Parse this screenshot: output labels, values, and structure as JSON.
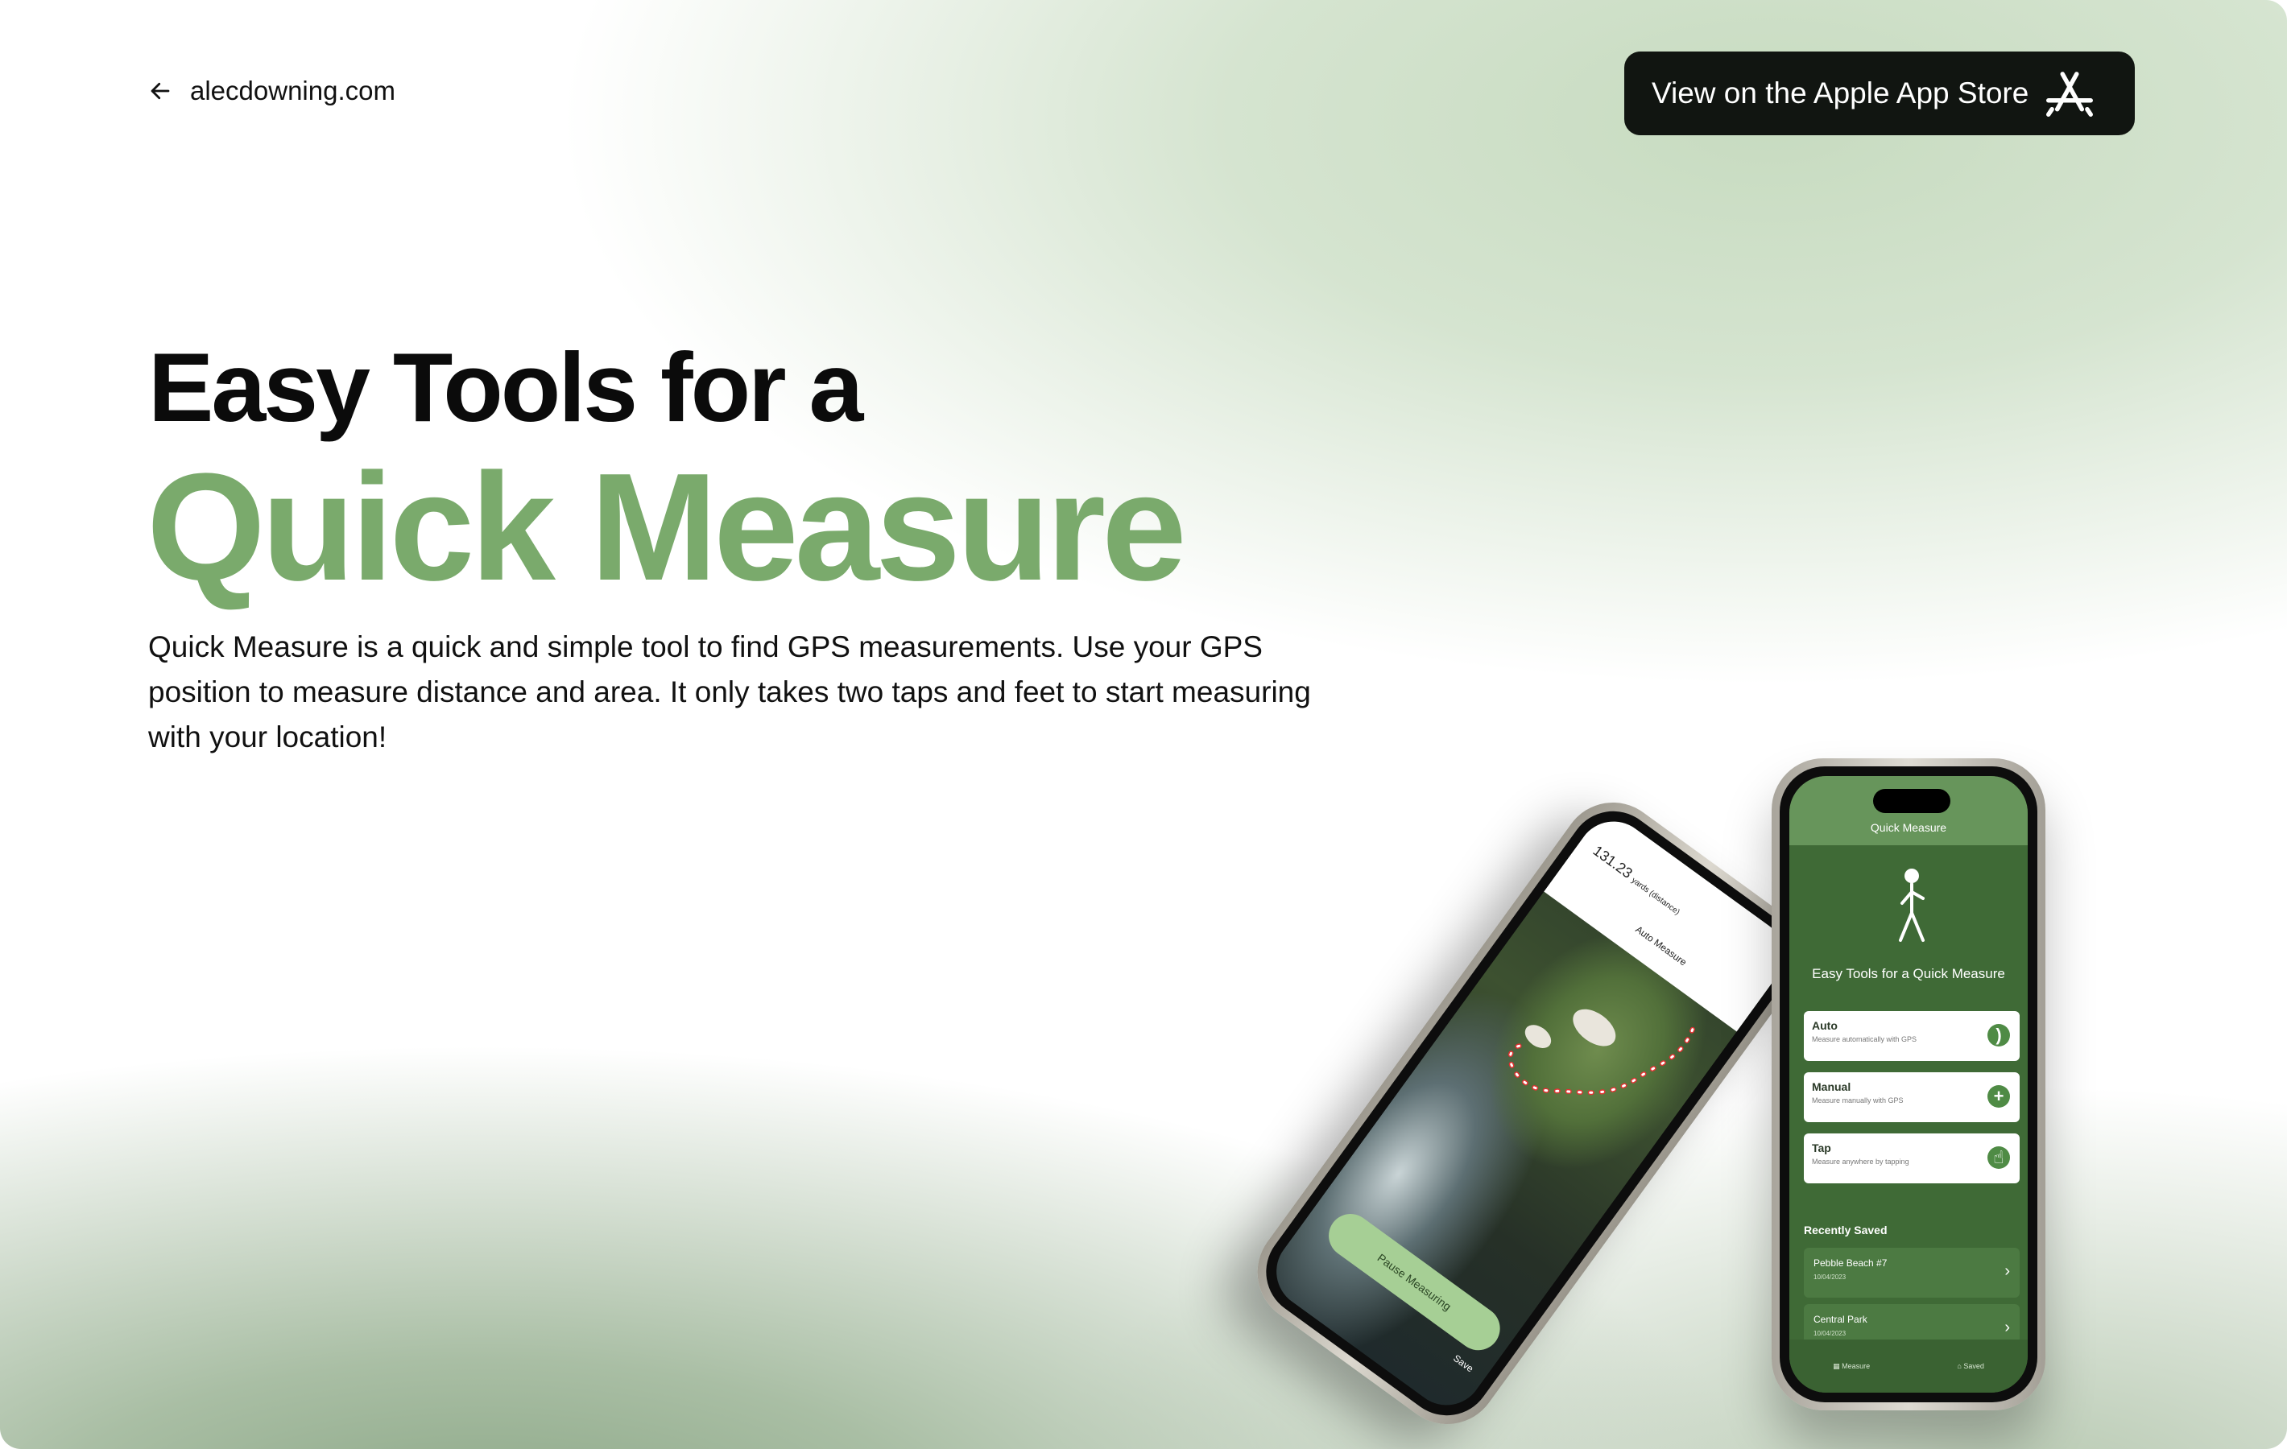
{
  "nav": {
    "back_label": "alecdowning.com",
    "store_button_label": "View on the Apple App Store"
  },
  "hero": {
    "title_line1": "Easy Tools for a",
    "title_line2": "Quick Measure",
    "description": "Quick Measure is a quick and simple tool to find GPS measurements. Use your GPS position to measure distance and area. It only takes two taps and feet to start measuring with your location!"
  },
  "phone_home": {
    "header_title": "Quick Measure",
    "tagline": "Easy Tools for a Quick Measure",
    "modes": [
      {
        "title": "Auto",
        "subtitle": "Measure automatically with GPS",
        "icon": "gps-signal-icon"
      },
      {
        "title": "Manual",
        "subtitle": "Measure manually with GPS",
        "icon": "plus-icon"
      },
      {
        "title": "Tap",
        "subtitle": "Measure anywhere by tapping",
        "icon": "tap-hand-icon"
      }
    ],
    "recent_label": "Recently Saved",
    "recent": [
      {
        "title": "Pebble Beach #7",
        "date": "10/04/2023"
      },
      {
        "title": "Central Park",
        "date": "10/04/2023"
      }
    ],
    "tabs": [
      "Measure",
      "Saved"
    ]
  },
  "phone_map": {
    "distance_value": "131.23",
    "distance_unit": "yards (distance)",
    "mode_title": "Auto Measure",
    "pause_label": "Pause Measuring",
    "save_label": "Save"
  },
  "colors": {
    "accent_green": "#7aaa6c",
    "app_green": "#3f6a36",
    "button_dark": "#111511"
  }
}
